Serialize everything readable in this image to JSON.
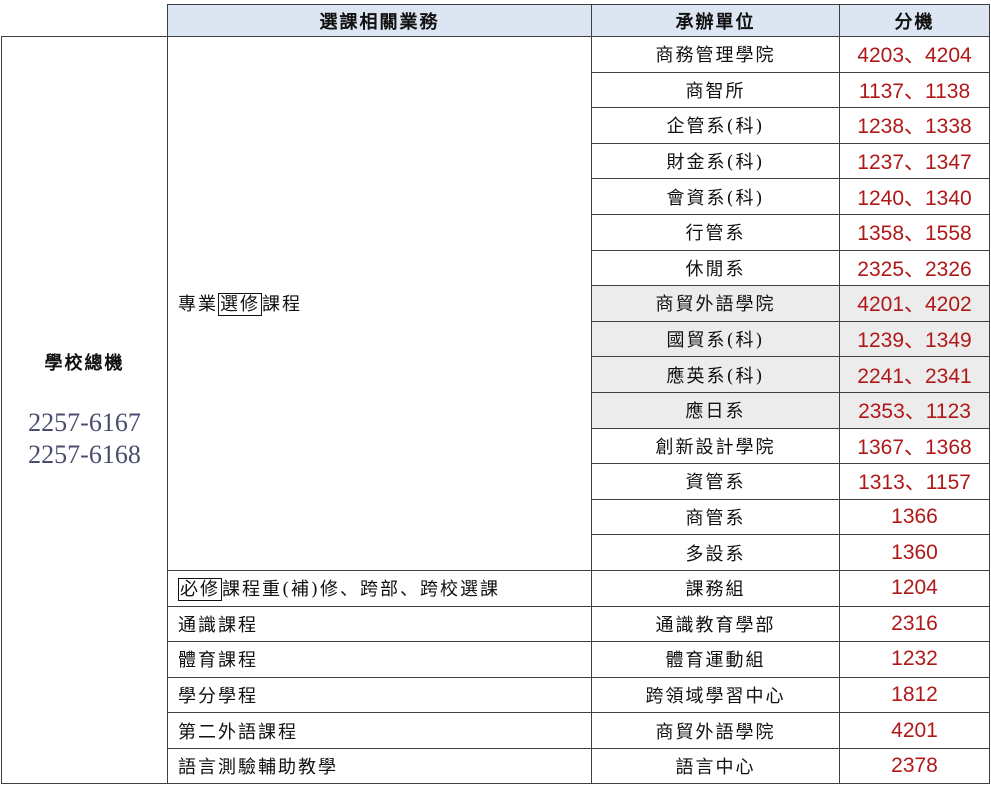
{
  "header": {
    "task": "選課相關業務",
    "unit": "承辦單位",
    "ext": "分機"
  },
  "switchboard": {
    "title": "學校總機",
    "phones": [
      "2257-6167",
      "2257-6168"
    ]
  },
  "elective": {
    "label_pre": "專業",
    "label_boxed": "選修",
    "label_post": "課程",
    "rows": [
      {
        "unit": "商務管理學院",
        "ext": "4203、4204"
      },
      {
        "unit": "商智所",
        "ext": "1137、1138"
      },
      {
        "unit": "企管系(科)",
        "ext": "1238、1338"
      },
      {
        "unit": "財金系(科)",
        "ext": "1237、1347"
      },
      {
        "unit": "會資系(科)",
        "ext": "1240、1340"
      },
      {
        "unit": "行管系",
        "ext": "1358、1558"
      },
      {
        "unit": "休閒系",
        "ext": "2325、2326"
      },
      {
        "unit": "商貿外語學院",
        "ext": "4201、4202"
      },
      {
        "unit": "國貿系(科)",
        "ext": "1239、1349"
      },
      {
        "unit": "應英系(科)",
        "ext": "2241、2341"
      },
      {
        "unit": "應日系",
        "ext": "2353、1123"
      },
      {
        "unit": "創新設計學院",
        "ext": "1367、1368"
      },
      {
        "unit": "資管系",
        "ext": "1313、1157"
      },
      {
        "unit": "商管系",
        "ext": "1366"
      },
      {
        "unit": "多設系",
        "ext": "1360"
      }
    ]
  },
  "required": {
    "label_boxed": "必修",
    "label_post": "課程重(補)修、跨部、跨校選課",
    "unit": "課務組",
    "ext": "1204"
  },
  "others": [
    {
      "task": "通識課程",
      "unit": "通識教育學部",
      "ext": "2316"
    },
    {
      "task": "體育課程",
      "unit": "體育運動組",
      "ext": "1232"
    },
    {
      "task": "學分學程",
      "unit": "跨領域學習中心",
      "ext": "1812"
    },
    {
      "task": "第二外語課程",
      "unit": "商貿外語學院",
      "ext": "4201"
    },
    {
      "task": "語言測驗輔助教學",
      "unit": "語言中心",
      "ext": "2378"
    }
  ]
}
